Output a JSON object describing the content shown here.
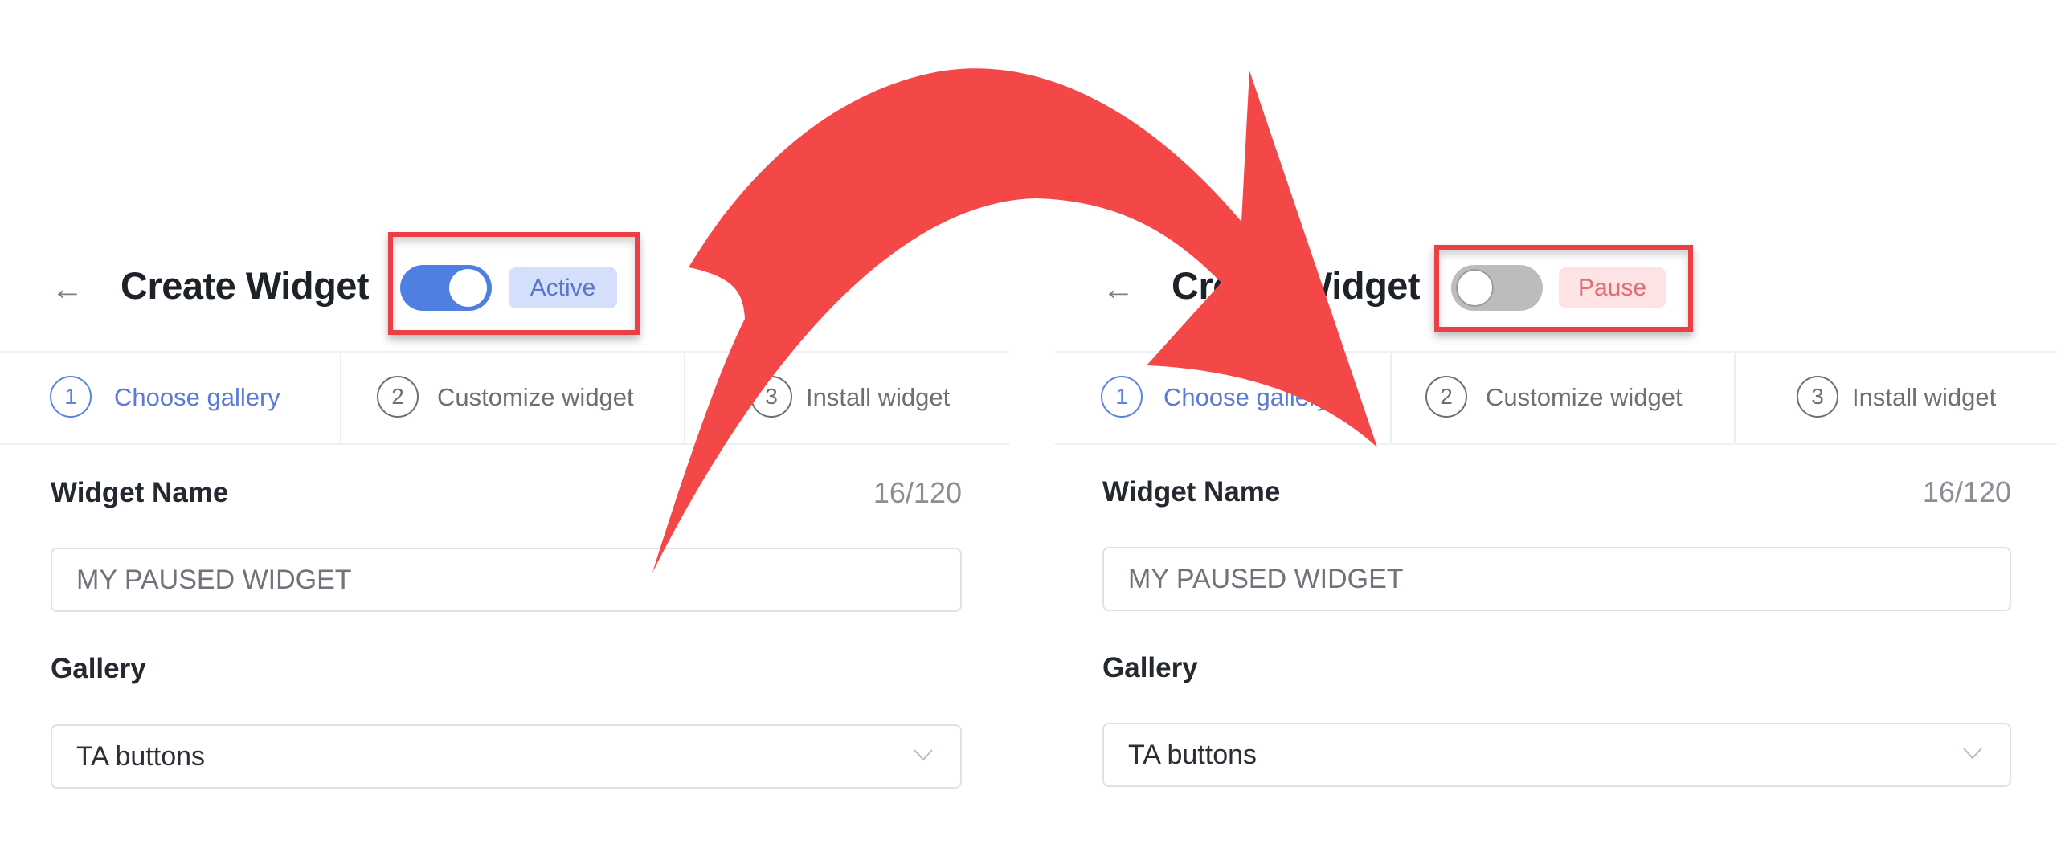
{
  "annotation": {
    "arrow_color": "#f44848",
    "highlight_color": "#ea3f44"
  },
  "panels": [
    {
      "id": "before",
      "header": {
        "back_icon": "arrow-left-icon",
        "back_glyph": "←",
        "title": "Create Widget",
        "toggle": {
          "state": "on",
          "color": "#4f7fe0"
        },
        "status_badge": {
          "label": "Active",
          "variant": "active",
          "bg": "#d4e0fb",
          "fg": "#5b77c9"
        }
      },
      "steps": [
        {
          "number": "1",
          "label": "Choose gallery",
          "current": true
        },
        {
          "number": "2",
          "label": "Customize widget",
          "current": false
        },
        {
          "number": "3",
          "label": "Install widget",
          "current": false
        }
      ],
      "form": {
        "name_label": "Widget Name",
        "name_counter": "16/120",
        "name_value": "MY PAUSED WIDGET",
        "gallery_label": "Gallery",
        "gallery_value": "TA buttons",
        "gallery_icon": "chevron-down-icon"
      }
    },
    {
      "id": "after",
      "header": {
        "back_icon": "arrow-left-icon",
        "back_glyph": "←",
        "title": "Create Widget",
        "toggle": {
          "state": "off",
          "color": "#bcbcbc"
        },
        "status_badge": {
          "label": "Pause",
          "variant": "pause",
          "bg": "#fde3e3",
          "fg": "#e36c72"
        }
      },
      "steps": [
        {
          "number": "1",
          "label": "Choose gallery",
          "current": true
        },
        {
          "number": "2",
          "label": "Customize widget",
          "current": false
        },
        {
          "number": "3",
          "label": "Install widget",
          "current": false
        }
      ],
      "form": {
        "name_label": "Widget Name",
        "name_counter": "16/120",
        "name_value": "MY PAUSED WIDGET",
        "gallery_label": "Gallery",
        "gallery_value": "TA buttons",
        "gallery_icon": "chevron-down-icon"
      }
    }
  ]
}
